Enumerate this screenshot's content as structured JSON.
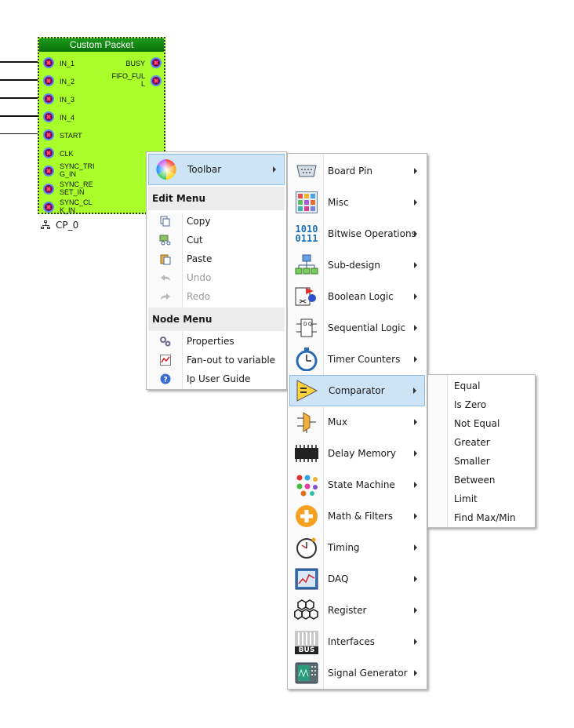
{
  "block": {
    "title": "Custom Packet",
    "node_name": "CP_0",
    "left_ports": [
      "IN_1",
      "IN_2",
      "IN_3",
      "IN_4",
      "START",
      "CLK",
      "SYNC_TRI\nG_IN",
      "SYNC_RE\nSET_IN",
      "SYNC_CL\nK_IN"
    ],
    "right_ports": [
      "BUSY",
      "FIFO_FUL\nL"
    ]
  },
  "context_menu": {
    "toolbar_label": "Toolbar",
    "edit_menu_title": "Edit Menu",
    "edit_items": [
      {
        "label": "Copy",
        "icon": "copy-icon",
        "enabled": true
      },
      {
        "label": "Cut",
        "icon": "cut-icon",
        "enabled": true
      },
      {
        "label": "Paste",
        "icon": "paste-icon",
        "enabled": true
      },
      {
        "label": "Undo",
        "icon": "undo-icon",
        "enabled": false
      },
      {
        "label": "Redo",
        "icon": "redo-icon",
        "enabled": false
      }
    ],
    "node_menu_title": "Node Menu",
    "node_items": [
      {
        "label": "Properties",
        "icon": "gears-icon"
      },
      {
        "label": "Fan-out to variable",
        "icon": "chart-icon"
      },
      {
        "label": "Ip User Guide",
        "icon": "help-icon"
      }
    ]
  },
  "toolbar_menu": {
    "items": [
      {
        "label": "Board Pin",
        "icon": "board-pin-icon"
      },
      {
        "label": "Misc",
        "icon": "misc-icon"
      },
      {
        "label": "Bitwise Operations",
        "icon": "bitwise-icon"
      },
      {
        "label": "Sub-design",
        "icon": "subdesign-icon"
      },
      {
        "label": "Boolean Logic",
        "icon": "boolean-logic-icon"
      },
      {
        "label": "Sequential Logic",
        "icon": "flipflop-icon"
      },
      {
        "label": "Timer Counters",
        "icon": "stopwatch-icon"
      },
      {
        "label": "Comparator",
        "icon": "comparator-icon"
      },
      {
        "label": "Mux",
        "icon": "mux-icon"
      },
      {
        "label": "Delay Memory",
        "icon": "chip-icon"
      },
      {
        "label": "State Machine",
        "icon": "state-machine-icon"
      },
      {
        "label": "Math & Filters",
        "icon": "plus-icon"
      },
      {
        "label": "Timing",
        "icon": "clock-icon"
      },
      {
        "label": "DAQ",
        "icon": "daq-icon"
      },
      {
        "label": "Register",
        "icon": "register-icon"
      },
      {
        "label": "Interfaces",
        "icon": "bus-icon"
      },
      {
        "label": "Signal Generator",
        "icon": "signal-generator-icon"
      }
    ],
    "bitwise_icon_text": [
      "1010",
      "0111"
    ],
    "bus_icon_text": "BUS"
  },
  "comparator_menu": {
    "items": [
      "Equal",
      "Is Zero",
      "Not Equal",
      "Greater",
      "Smaller",
      "Between",
      "Limit",
      "Find Max/Min"
    ]
  },
  "colors": {
    "block_fill": "#a8ff2a",
    "title_bar": "#0a720a",
    "highlight": "#cde4f7",
    "highlight_border": "#8fbde6"
  }
}
